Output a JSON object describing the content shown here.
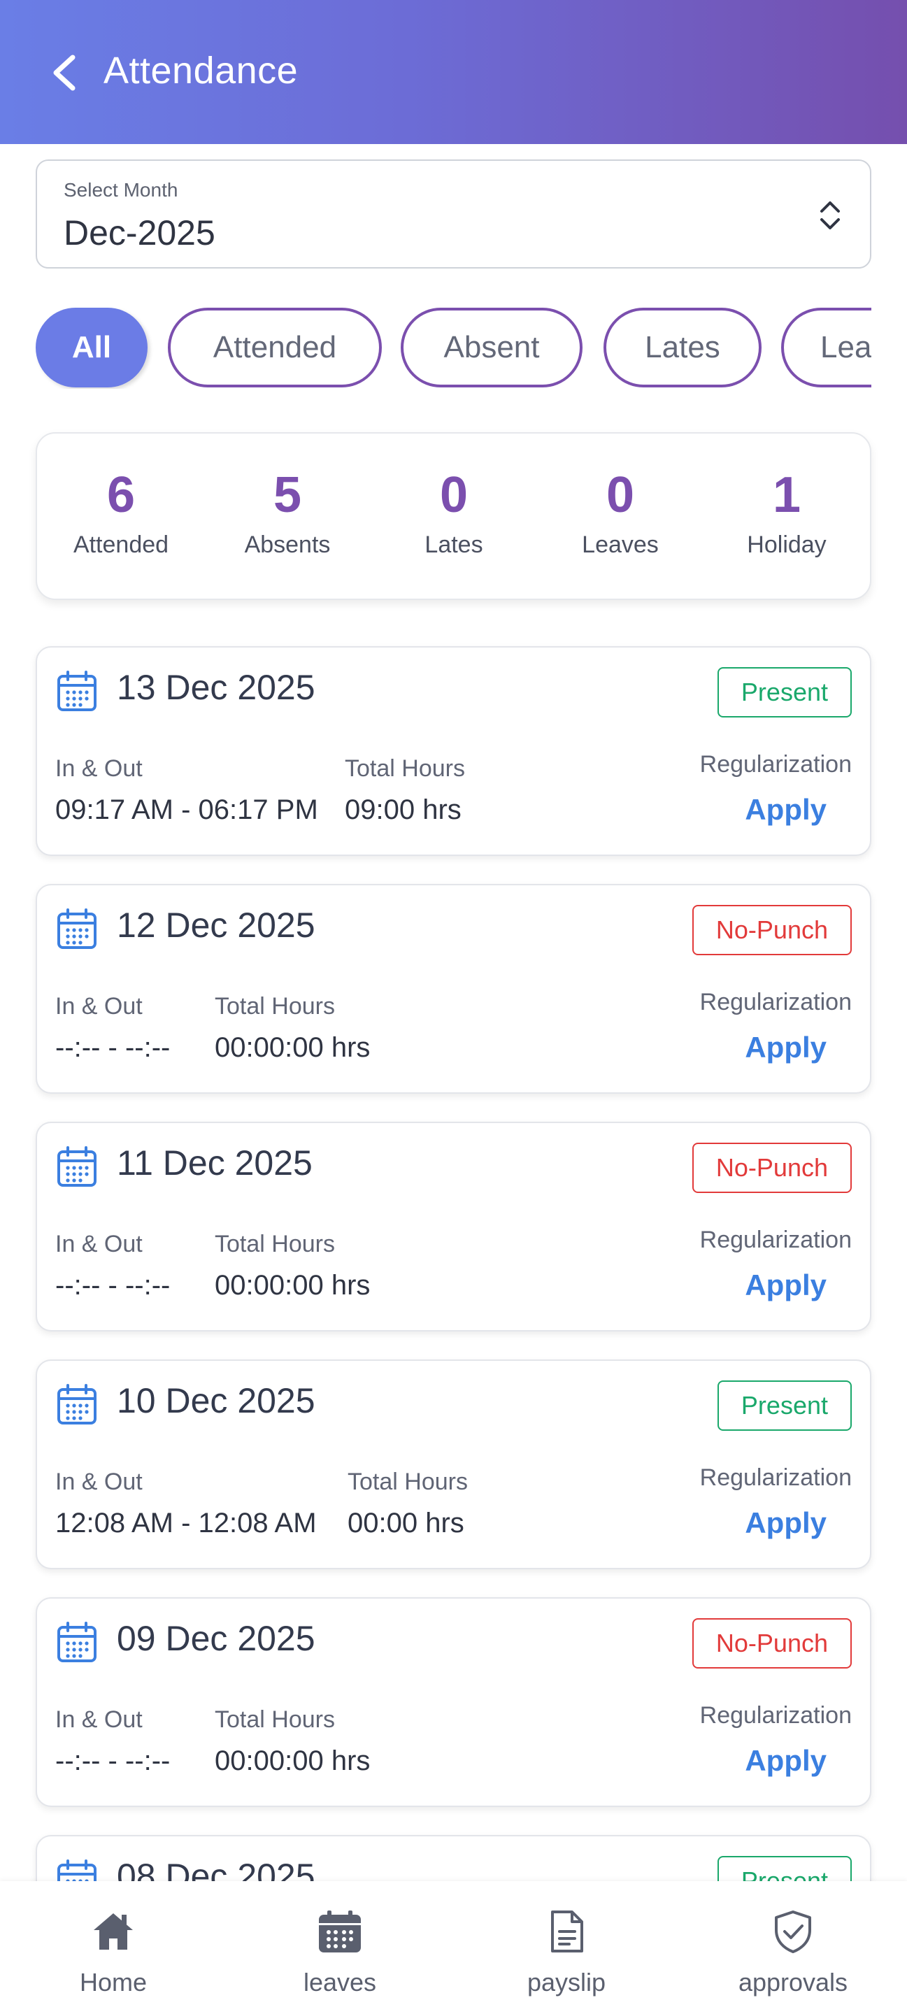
{
  "header": {
    "title": "Attendance",
    "back_icon": "chevron-left-icon"
  },
  "month_select": {
    "label": "Select Month",
    "value": "Dec-2025"
  },
  "filters": [
    {
      "label": "All",
      "active": true
    },
    {
      "label": "Attended",
      "active": false
    },
    {
      "label": "Absent",
      "active": false
    },
    {
      "label": "Lates",
      "active": false
    },
    {
      "label": "Lea",
      "active": false
    }
  ],
  "summary": [
    {
      "count": "6",
      "label": "Attended"
    },
    {
      "count": "5",
      "label": "Absents"
    },
    {
      "count": "0",
      "label": "Lates"
    },
    {
      "count": "0",
      "label": "Leaves"
    },
    {
      "count": "1",
      "label": "Holiday"
    }
  ],
  "labels": {
    "in_out": "In & Out",
    "total_hours": "Total Hours",
    "regularization": "Regularization",
    "apply": "Apply"
  },
  "records": [
    {
      "date": "13 Dec 2025",
      "status": "Present",
      "in_out": "09:17 AM - 06:17 PM",
      "total": "09:00 hrs"
    },
    {
      "date": "12 Dec 2025",
      "status": "No-Punch",
      "in_out": "--:-- - --:--",
      "total": "00:00:00 hrs"
    },
    {
      "date": "11 Dec 2025",
      "status": "No-Punch",
      "in_out": "--:-- - --:--",
      "total": "00:00:00 hrs"
    },
    {
      "date": "10 Dec 2025",
      "status": "Present",
      "in_out": "12:08 AM - 12:08 AM",
      "total": "00:00 hrs"
    },
    {
      "date": "09 Dec 2025",
      "status": "No-Punch",
      "in_out": "--:-- - --:--",
      "total": "00:00:00 hrs"
    },
    {
      "date": "08 Dec 2025",
      "status": "Present",
      "in_out": "",
      "total": ""
    }
  ],
  "bottom_nav": [
    {
      "label": "Home",
      "icon": "home-icon"
    },
    {
      "label": "leaves",
      "icon": "calendar-icon"
    },
    {
      "label": "payslip",
      "icon": "document-icon"
    },
    {
      "label": "approvals",
      "icon": "shield-check-icon"
    }
  ],
  "colors": {
    "header_start": "#6a7ee6",
    "header_end": "#754fae",
    "accent_purple": "#7b4fae",
    "present": "#1aa86b",
    "no_punch": "#e23a3a",
    "apply": "#3b7fe0"
  }
}
